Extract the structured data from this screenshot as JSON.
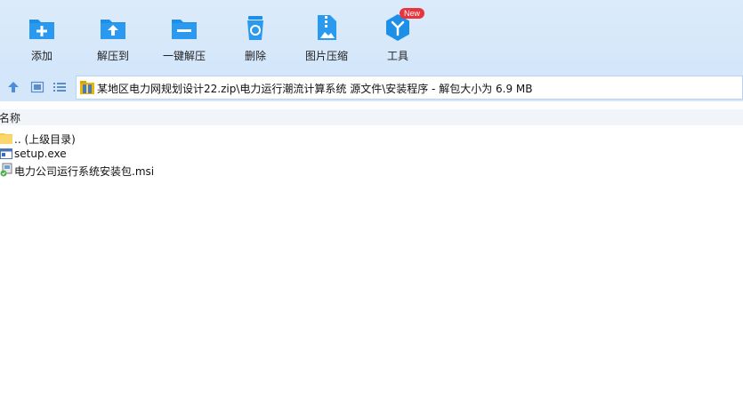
{
  "toolbar": {
    "items": [
      {
        "label": "添加",
        "icon": "add-icon"
      },
      {
        "label": "解压到",
        "icon": "extract-to-icon"
      },
      {
        "label": "一键解压",
        "icon": "one-click-extract-icon"
      },
      {
        "label": "删除",
        "icon": "delete-icon"
      },
      {
        "label": "图片压缩",
        "icon": "image-compress-icon"
      },
      {
        "label": "工具",
        "icon": "tools-icon"
      }
    ],
    "new_badge": "New",
    "accent": "#1e8fe6",
    "badge_color": "#e8343d"
  },
  "address": {
    "path": "某地区电力网规划设计22.zip\\电力运行潮流计算系统 源文件\\安装程序 - 解包大小为 6.9 MB"
  },
  "list": {
    "column_name": "名称",
    "rows": [
      {
        "name": ".. (上级目录)",
        "icon": "folder-icon"
      },
      {
        "name": "setup.exe",
        "icon": "exe-icon"
      },
      {
        "name": "电力公司运行系统安装包.msi",
        "icon": "msi-icon"
      }
    ]
  }
}
